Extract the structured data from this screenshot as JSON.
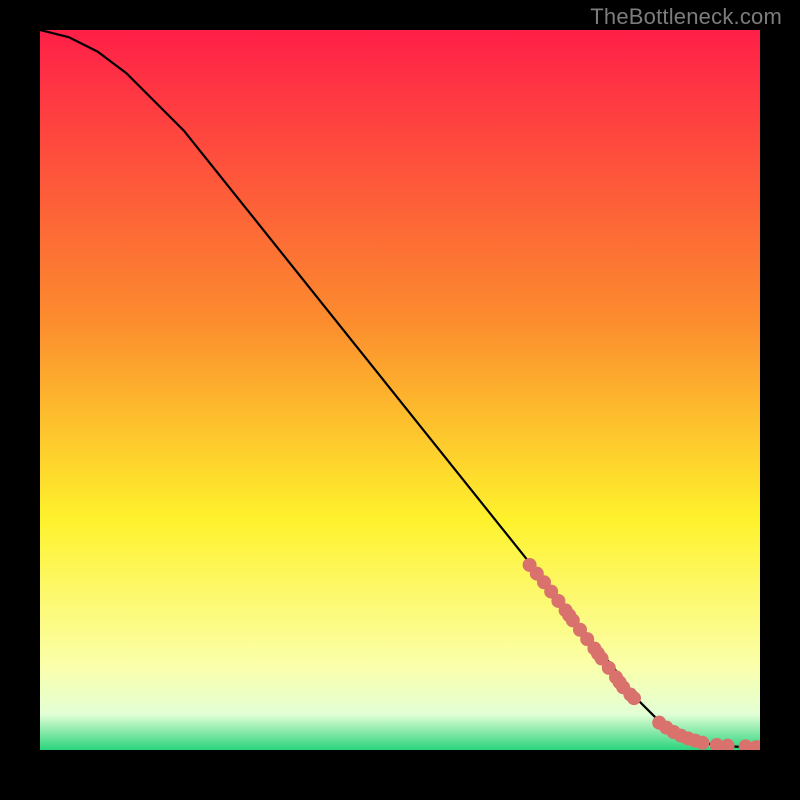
{
  "watermark": "TheBottleneck.com",
  "colors": {
    "background": "#000000",
    "curve": "#000000",
    "marker": "#d9716d",
    "gradient_top": "#ff1f48",
    "gradient_mid1": "#fc8b2e",
    "gradient_mid2": "#fef22c",
    "gradient_mid3": "#fbffa8",
    "gradient_mid4": "#e3ffd5",
    "gradient_bottom": "#2ad47d"
  },
  "chart_data": {
    "type": "line",
    "title": "",
    "xlabel": "",
    "ylabel": "",
    "xlim": [
      0,
      100
    ],
    "ylim": [
      0,
      100
    ],
    "series": [
      {
        "name": "curve",
        "x": [
          0,
          4,
          8,
          12,
          16,
          20,
          24,
          28,
          32,
          36,
          40,
          44,
          48,
          52,
          56,
          60,
          64,
          68,
          72,
          76,
          80,
          82,
          84,
          86,
          88,
          90,
          92,
          94,
          96,
          98,
          100
        ],
        "y": [
          100,
          99,
          97,
          94,
          90,
          86,
          81,
          76,
          71,
          66,
          61,
          56,
          51,
          46,
          41,
          36,
          31,
          26,
          21,
          16,
          11,
          8,
          6,
          4,
          2.5,
          1.5,
          1,
          0.7,
          0.5,
          0.4,
          0.3
        ]
      }
    ],
    "markers": {
      "name": "points",
      "x": [
        68,
        69,
        70,
        71,
        72,
        73,
        73.5,
        74,
        75,
        76,
        77,
        77.5,
        78,
        79,
        80,
        80.5,
        81,
        82,
        82.5,
        86,
        87,
        88,
        89,
        90,
        91,
        92,
        94,
        95.5,
        98,
        99.5,
        100
      ],
      "y": [
        25.7,
        24.5,
        23.3,
        22.0,
        20.7,
        19.4,
        18.7,
        18.0,
        16.7,
        15.4,
        14.1,
        13.4,
        12.7,
        11.4,
        10.1,
        9.4,
        8.7,
        7.7,
        7.2,
        3.8,
        3.1,
        2.5,
        2.0,
        1.6,
        1.3,
        1.0,
        0.7,
        0.6,
        0.5,
        0.4,
        0.35
      ]
    }
  }
}
